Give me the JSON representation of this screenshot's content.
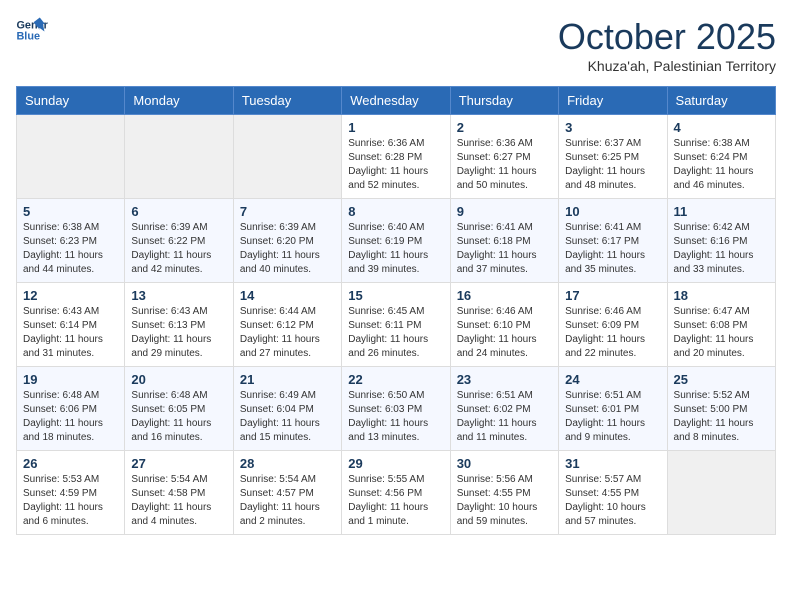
{
  "header": {
    "logo_line1": "General",
    "logo_line2": "Blue",
    "month": "October 2025",
    "location": "Khuza'ah, Palestinian Territory"
  },
  "days_of_week": [
    "Sunday",
    "Monday",
    "Tuesday",
    "Wednesday",
    "Thursday",
    "Friday",
    "Saturday"
  ],
  "weeks": [
    [
      {
        "day": "",
        "info": ""
      },
      {
        "day": "",
        "info": ""
      },
      {
        "day": "",
        "info": ""
      },
      {
        "day": "1",
        "info": "Sunrise: 6:36 AM\nSunset: 6:28 PM\nDaylight: 11 hours\nand 52 minutes."
      },
      {
        "day": "2",
        "info": "Sunrise: 6:36 AM\nSunset: 6:27 PM\nDaylight: 11 hours\nand 50 minutes."
      },
      {
        "day": "3",
        "info": "Sunrise: 6:37 AM\nSunset: 6:25 PM\nDaylight: 11 hours\nand 48 minutes."
      },
      {
        "day": "4",
        "info": "Sunrise: 6:38 AM\nSunset: 6:24 PM\nDaylight: 11 hours\nand 46 minutes."
      }
    ],
    [
      {
        "day": "5",
        "info": "Sunrise: 6:38 AM\nSunset: 6:23 PM\nDaylight: 11 hours\nand 44 minutes."
      },
      {
        "day": "6",
        "info": "Sunrise: 6:39 AM\nSunset: 6:22 PM\nDaylight: 11 hours\nand 42 minutes."
      },
      {
        "day": "7",
        "info": "Sunrise: 6:39 AM\nSunset: 6:20 PM\nDaylight: 11 hours\nand 40 minutes."
      },
      {
        "day": "8",
        "info": "Sunrise: 6:40 AM\nSunset: 6:19 PM\nDaylight: 11 hours\nand 39 minutes."
      },
      {
        "day": "9",
        "info": "Sunrise: 6:41 AM\nSunset: 6:18 PM\nDaylight: 11 hours\nand 37 minutes."
      },
      {
        "day": "10",
        "info": "Sunrise: 6:41 AM\nSunset: 6:17 PM\nDaylight: 11 hours\nand 35 minutes."
      },
      {
        "day": "11",
        "info": "Sunrise: 6:42 AM\nSunset: 6:16 PM\nDaylight: 11 hours\nand 33 minutes."
      }
    ],
    [
      {
        "day": "12",
        "info": "Sunrise: 6:43 AM\nSunset: 6:14 PM\nDaylight: 11 hours\nand 31 minutes."
      },
      {
        "day": "13",
        "info": "Sunrise: 6:43 AM\nSunset: 6:13 PM\nDaylight: 11 hours\nand 29 minutes."
      },
      {
        "day": "14",
        "info": "Sunrise: 6:44 AM\nSunset: 6:12 PM\nDaylight: 11 hours\nand 27 minutes."
      },
      {
        "day": "15",
        "info": "Sunrise: 6:45 AM\nSunset: 6:11 PM\nDaylight: 11 hours\nand 26 minutes."
      },
      {
        "day": "16",
        "info": "Sunrise: 6:46 AM\nSunset: 6:10 PM\nDaylight: 11 hours\nand 24 minutes."
      },
      {
        "day": "17",
        "info": "Sunrise: 6:46 AM\nSunset: 6:09 PM\nDaylight: 11 hours\nand 22 minutes."
      },
      {
        "day": "18",
        "info": "Sunrise: 6:47 AM\nSunset: 6:08 PM\nDaylight: 11 hours\nand 20 minutes."
      }
    ],
    [
      {
        "day": "19",
        "info": "Sunrise: 6:48 AM\nSunset: 6:06 PM\nDaylight: 11 hours\nand 18 minutes."
      },
      {
        "day": "20",
        "info": "Sunrise: 6:48 AM\nSunset: 6:05 PM\nDaylight: 11 hours\nand 16 minutes."
      },
      {
        "day": "21",
        "info": "Sunrise: 6:49 AM\nSunset: 6:04 PM\nDaylight: 11 hours\nand 15 minutes."
      },
      {
        "day": "22",
        "info": "Sunrise: 6:50 AM\nSunset: 6:03 PM\nDaylight: 11 hours\nand 13 minutes."
      },
      {
        "day": "23",
        "info": "Sunrise: 6:51 AM\nSunset: 6:02 PM\nDaylight: 11 hours\nand 11 minutes."
      },
      {
        "day": "24",
        "info": "Sunrise: 6:51 AM\nSunset: 6:01 PM\nDaylight: 11 hours\nand 9 minutes."
      },
      {
        "day": "25",
        "info": "Sunrise: 5:52 AM\nSunset: 5:00 PM\nDaylight: 11 hours\nand 8 minutes."
      }
    ],
    [
      {
        "day": "26",
        "info": "Sunrise: 5:53 AM\nSunset: 4:59 PM\nDaylight: 11 hours\nand 6 minutes."
      },
      {
        "day": "27",
        "info": "Sunrise: 5:54 AM\nSunset: 4:58 PM\nDaylight: 11 hours\nand 4 minutes."
      },
      {
        "day": "28",
        "info": "Sunrise: 5:54 AM\nSunset: 4:57 PM\nDaylight: 11 hours\nand 2 minutes."
      },
      {
        "day": "29",
        "info": "Sunrise: 5:55 AM\nSunset: 4:56 PM\nDaylight: 11 hours\nand 1 minute."
      },
      {
        "day": "30",
        "info": "Sunrise: 5:56 AM\nSunset: 4:55 PM\nDaylight: 10 hours\nand 59 minutes."
      },
      {
        "day": "31",
        "info": "Sunrise: 5:57 AM\nSunset: 4:55 PM\nDaylight: 10 hours\nand 57 minutes."
      },
      {
        "day": "",
        "info": ""
      }
    ]
  ]
}
